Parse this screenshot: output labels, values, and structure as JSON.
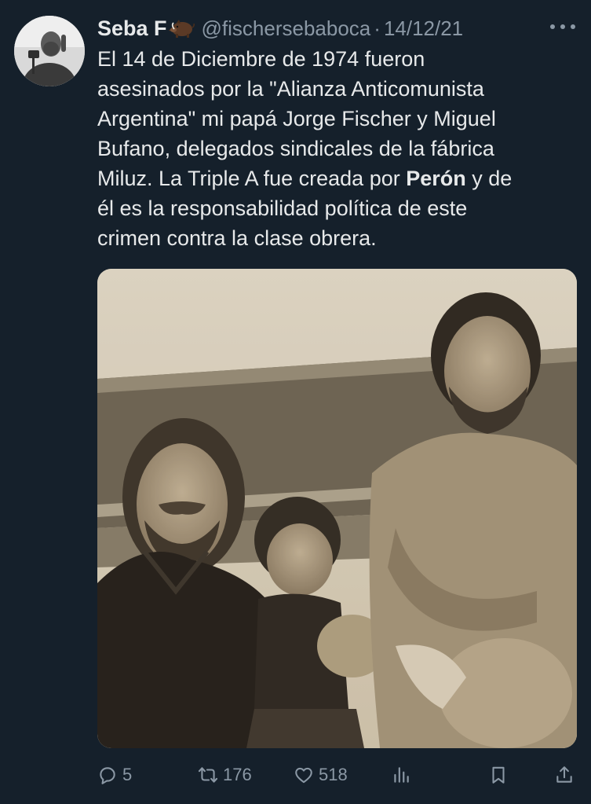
{
  "tweet": {
    "author": {
      "display_name": "Seba F",
      "name_emoji": "boar-emoji",
      "handle": "@fischersebaboca",
      "separator": "·",
      "date": "14/12/21"
    },
    "text": {
      "line1": "El 14 de Diciembre de 1974 fueron",
      "line2": "asesinados por la \"Alianza Anticomunista",
      "line3": "Argentina\" mi papá Jorge Fischer y Miguel",
      "line4": "Bufano, delegados sindicales de la fábrica",
      "line5_before": "Miluz. La Triple A fue creada por ",
      "line5_bold": "Perón",
      "line5_after": " y de",
      "line6": "él es la responsabilidad política de este",
      "line7": "crimen contra la clase obrera."
    },
    "media": {
      "kind": "black-and-white-photo"
    },
    "actions": {
      "reply_count": "5",
      "retweet_count": "176",
      "like_count": "518",
      "icons": [
        "reply-icon",
        "retweet-icon",
        "like-icon",
        "views-icon",
        "bookmark-icon",
        "share-icon"
      ]
    }
  },
  "colors": {
    "background": "#15202b",
    "text": "#e7e9ea",
    "muted": "#8b98a5"
  }
}
